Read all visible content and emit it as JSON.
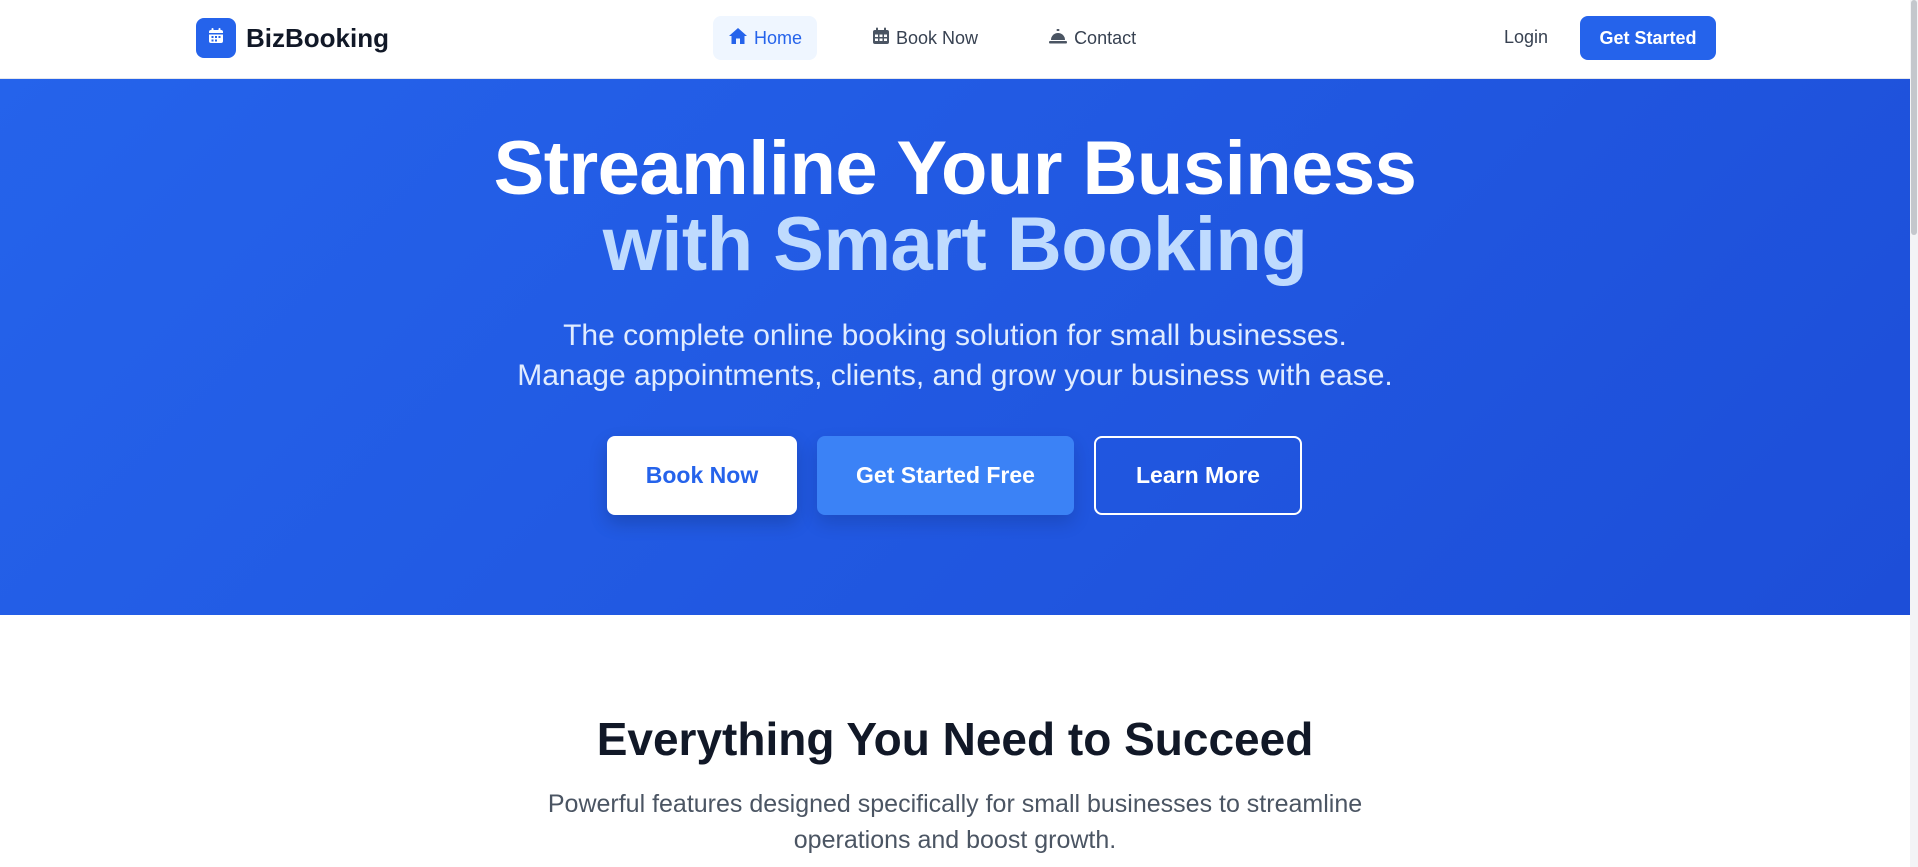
{
  "brand": {
    "name": "BizBooking",
    "icon": "calendar-icon",
    "color": "#2563eb"
  },
  "nav": {
    "items": [
      {
        "label": "Home",
        "icon": "home-icon",
        "active": true
      },
      {
        "label": "Book Now",
        "icon": "calendar-icon",
        "active": false
      },
      {
        "label": "Contact",
        "icon": "bell-icon",
        "active": false
      }
    ],
    "login": "Login",
    "cta": "Get Started"
  },
  "hero": {
    "title_line1": "Streamline Your Business",
    "title_line2": "with Smart Booking",
    "subtitle_line1": "The complete online booking solution for small businesses.",
    "subtitle_line2": "Manage appointments, clients, and grow your business with ease.",
    "buttons": {
      "book": "Book Now",
      "start": "Get Started Free",
      "learn": "Learn More"
    },
    "colors": {
      "background": "#2563eb",
      "accent_text": "#bfdbfe"
    }
  },
  "features": {
    "title": "Everything You Need to Succeed",
    "subtitle": "Powerful features designed specifically for small businesses to streamline operations and boost growth."
  }
}
